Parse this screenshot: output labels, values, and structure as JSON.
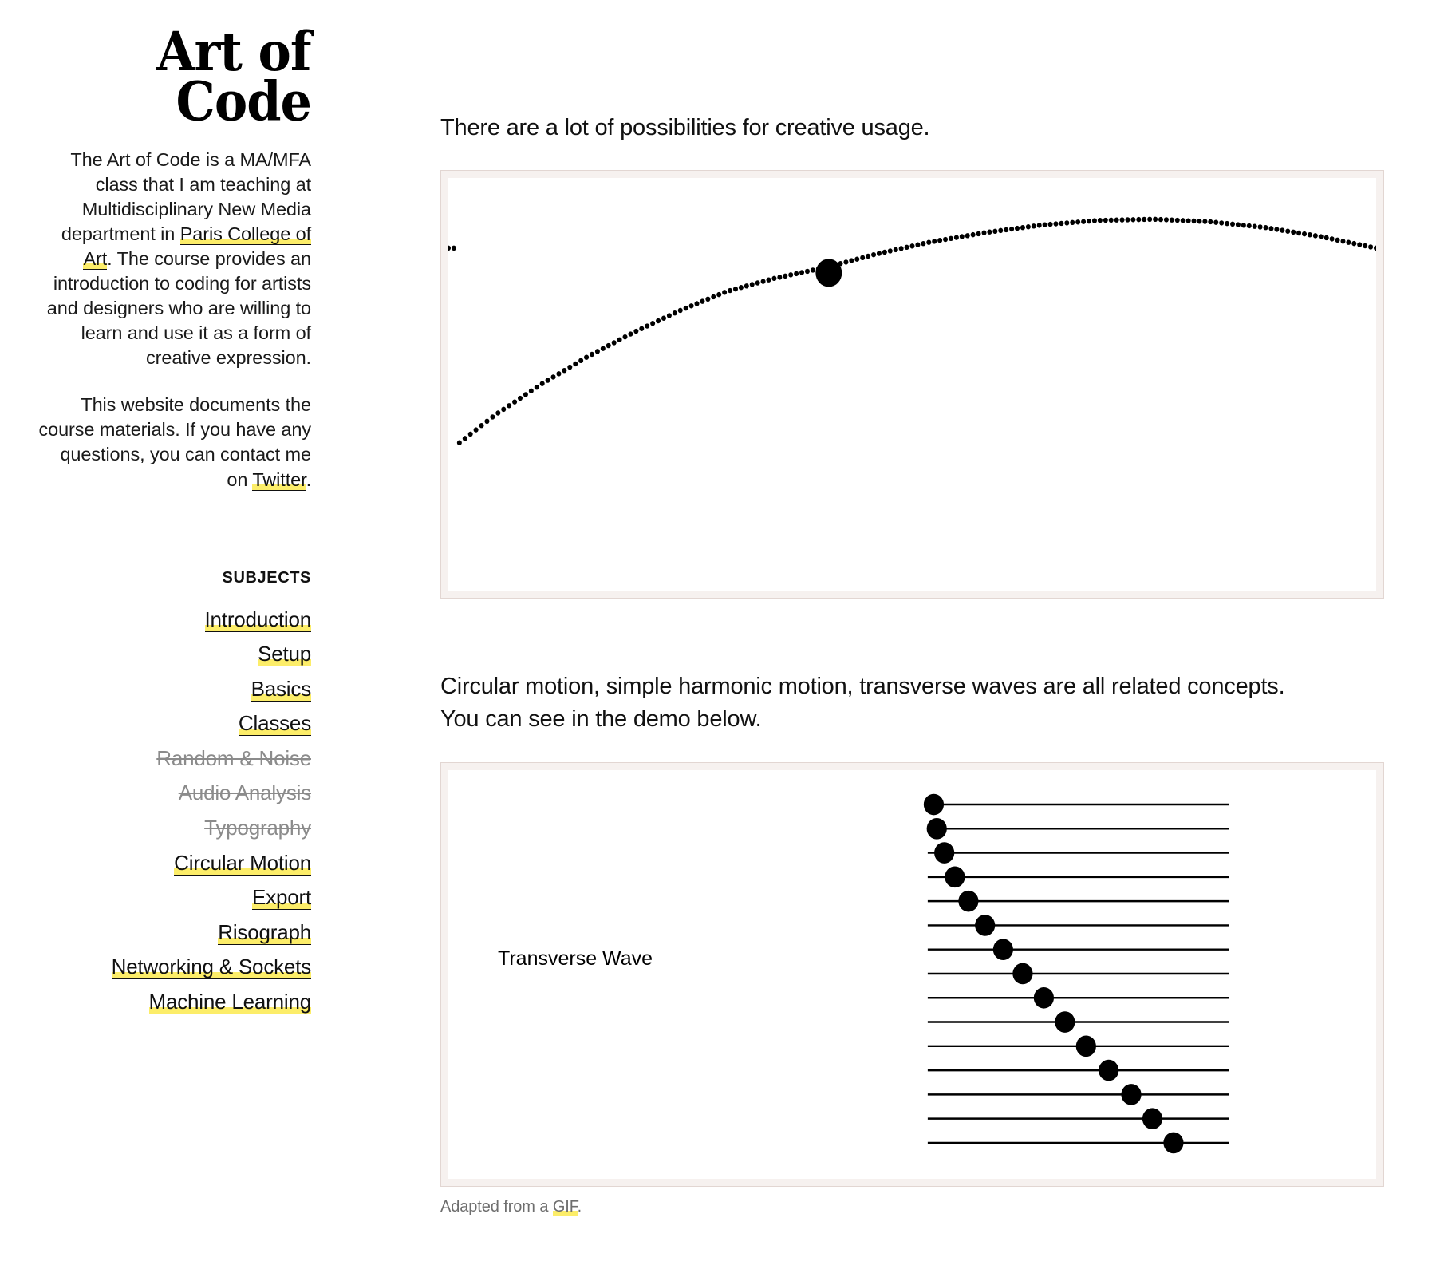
{
  "site": {
    "logo_line1": "Art of",
    "logo_line2": "Code"
  },
  "sidebar": {
    "intro_paragraph_1_a": "The Art of Code is a MA/MFA class that I am teaching at Multidisciplinary New Media department in ",
    "intro_link_1": "Paris College of Art",
    "intro_paragraph_1_b": ". The course provides an introduction to coding for artists and designers who are willing to learn and use it as a form of creative expression.",
    "intro_paragraph_2_a": "This website documents the course materials. If you have any questions, you can contact me on ",
    "intro_link_2": "Twitter",
    "intro_paragraph_2_b": ".",
    "subjects_title": "SUBJECTS",
    "subjects": [
      {
        "label": "Introduction",
        "state": "active"
      },
      {
        "label": "Setup",
        "state": "active"
      },
      {
        "label": "Basics",
        "state": "active"
      },
      {
        "label": "Classes",
        "state": "active"
      },
      {
        "label": "Random & Noise",
        "state": "disabled"
      },
      {
        "label": "Audio Analysis",
        "state": "disabled"
      },
      {
        "label": "Typography",
        "state": "disabled"
      },
      {
        "label": "Circular Motion",
        "state": "active"
      },
      {
        "label": "Export",
        "state": "active"
      },
      {
        "label": "Risograph",
        "state": "active"
      },
      {
        "label": "Networking & Sockets",
        "state": "active"
      },
      {
        "label": "Machine Learning",
        "state": "active"
      }
    ]
  },
  "main": {
    "lead_1": "There are a lot of possibilities for creative usage.",
    "lead_2": "Circular motion, simple harmonic motion, transverse waves are all related concepts. You can see in the demo below.",
    "wave_label": "Transverse Wave",
    "caption_a": "Adapted from a ",
    "caption_link": "GIF",
    "caption_b": "."
  },
  "colors": {
    "highlight": "#fced69",
    "panel_border": "#e2d6d2",
    "panel_mat": "#f6f1ef",
    "ink": "#111111",
    "muted": "#8b8b8b",
    "caption": "#6e6e6e"
  },
  "chart_data": [
    {
      "type": "scatter",
      "name": "dotted-arc-demo",
      "title": "",
      "xlabel": "",
      "ylabel": "",
      "description": "Dotted parabolic arc rising from lower-left, peaking right of centre, with a single large filled marker on the curve.",
      "marker": {
        "x": 0.41,
        "y": 0.77,
        "radius_px": 17
      },
      "curve_points": [
        [
          0.01,
          0.355
        ],
        [
          0.05,
          0.425
        ],
        [
          0.1,
          0.5
        ],
        [
          0.15,
          0.567
        ],
        [
          0.2,
          0.626
        ],
        [
          0.25,
          0.679
        ],
        [
          0.3,
          0.725
        ],
        [
          0.35,
          0.756
        ],
        [
          0.41,
          0.785
        ],
        [
          0.46,
          0.815
        ],
        [
          0.52,
          0.845
        ],
        [
          0.58,
          0.868
        ],
        [
          0.64,
          0.886
        ],
        [
          0.7,
          0.897
        ],
        [
          0.76,
          0.9
        ],
        [
          0.82,
          0.894
        ],
        [
          0.88,
          0.88
        ],
        [
          0.94,
          0.858
        ],
        [
          1.0,
          0.83
        ]
      ],
      "xlim": [
        0,
        1
      ],
      "ylim": [
        0,
        1
      ],
      "grid": false,
      "legend": false
    },
    {
      "type": "line",
      "name": "transverse-wave-demo",
      "title": "Transverse Wave",
      "xlabel": "",
      "ylabel": "",
      "description": "Fifteen evenly spaced horizontal guide lines; each carries one filled circular marker whose horizontal offset traces a descending wave front (sine-like phase delay).",
      "line_count": 15,
      "line_x_start": 0.0,
      "line_x_end": 1.0,
      "marker_radius_px": 13,
      "marker_offsets": [
        0.02,
        0.03,
        0.055,
        0.09,
        0.135,
        0.19,
        0.25,
        0.315,
        0.385,
        0.455,
        0.525,
        0.6,
        0.675,
        0.745,
        0.815
      ],
      "xlim": [
        0,
        1
      ],
      "ylim": [
        0,
        1
      ],
      "grid": false,
      "legend": false
    }
  ]
}
